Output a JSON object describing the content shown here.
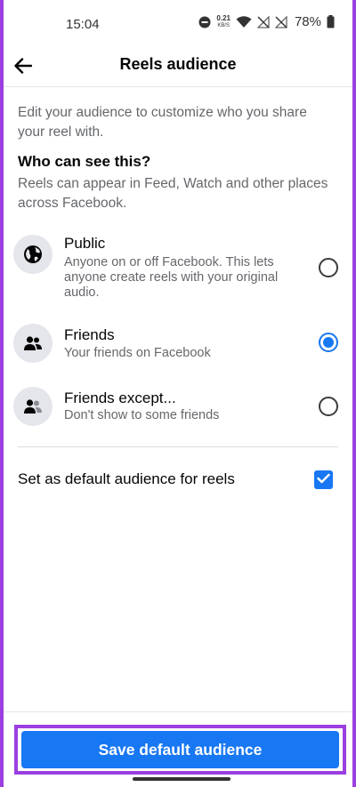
{
  "status_bar": {
    "time": "15:04",
    "net_speed_value": "0.21",
    "net_speed_unit": "KB/S",
    "battery": "78%"
  },
  "header": {
    "title": "Reels audience"
  },
  "intro": "Edit your audience to customize who you share your reel with.",
  "section": {
    "title": "Who can see this?",
    "description": "Reels can appear in Feed, Watch and other places across Facebook."
  },
  "options": [
    {
      "title": "Public",
      "description": "Anyone on or off Facebook. This lets anyone create reels with your original audio.",
      "icon": "globe-icon",
      "selected": false
    },
    {
      "title": "Friends",
      "description": "Your friends on Facebook",
      "icon": "friends-icon",
      "selected": true
    },
    {
      "title": "Friends except...",
      "description": "Don't show to some friends",
      "icon": "friends-except-icon",
      "selected": false
    }
  ],
  "default_setting": {
    "label": "Set as default audience for reels",
    "checked": true
  },
  "save_button": {
    "label": "Save default audience"
  },
  "colors": {
    "accent": "#1877f2",
    "highlight": "#9b3fe0",
    "text_primary": "#050505",
    "text_secondary": "#65676b"
  }
}
